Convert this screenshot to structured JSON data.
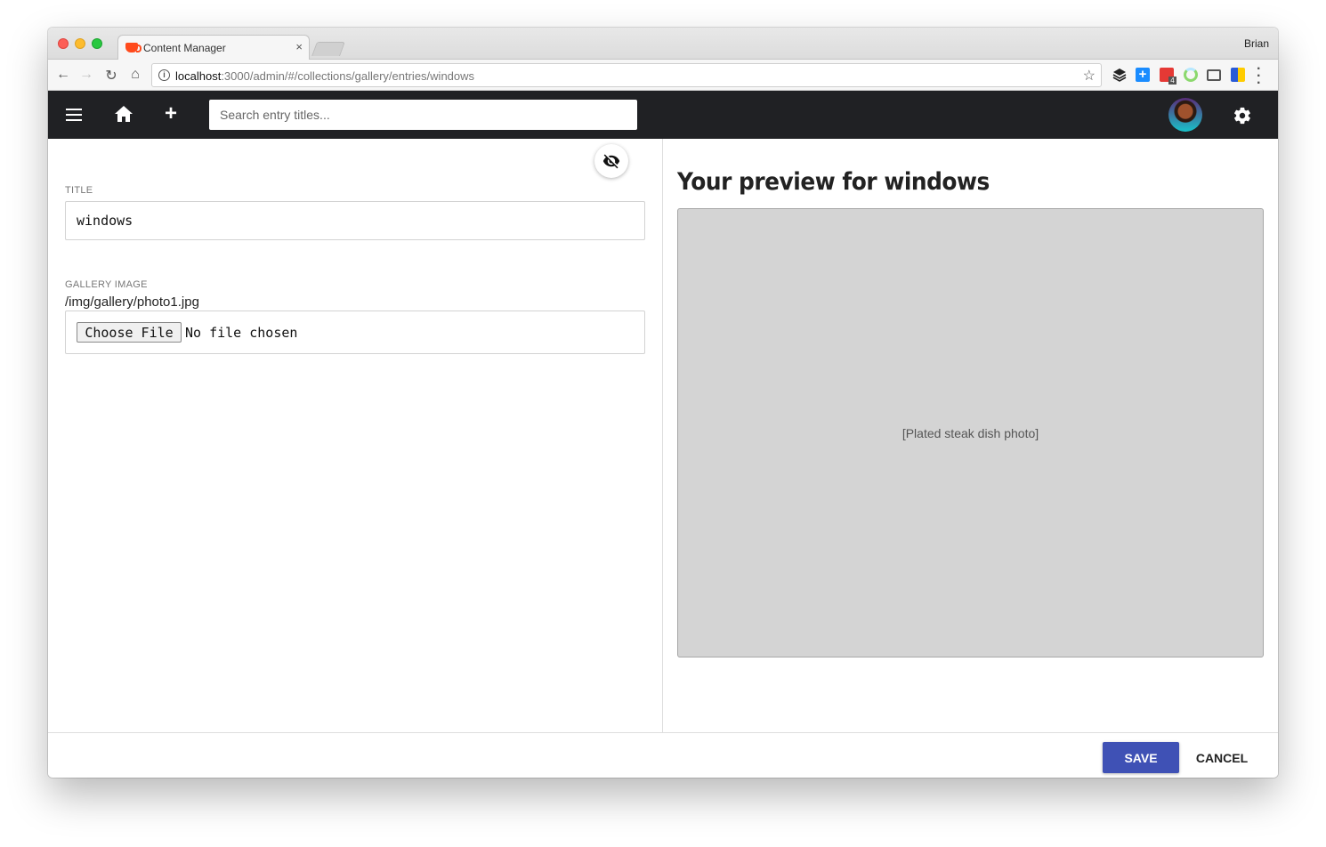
{
  "browser": {
    "tab_title": "Content Manager",
    "tab_close": "×",
    "profile_name": "Brian",
    "url_host": "localhost",
    "url_path": ":3000/admin/#/collections/gallery/entries/windows"
  },
  "app": {
    "search_placeholder": "Search entry titles...",
    "plus_glyph": "+"
  },
  "editor": {
    "title_label": "TITLE",
    "title_value": "windows",
    "gallery_label": "GALLERY IMAGE",
    "gallery_path": "/img/gallery/photo1.jpg",
    "choose_file_label": "Choose File",
    "no_file_text": "No file chosen"
  },
  "preview": {
    "heading": "Your preview for windows",
    "image_label": "[Plated steak dish photo]"
  },
  "footer": {
    "save_label": "SAVE",
    "cancel_label": "CANCEL"
  },
  "colors": {
    "appbar": "#202124",
    "save_button": "#3f51b5"
  }
}
